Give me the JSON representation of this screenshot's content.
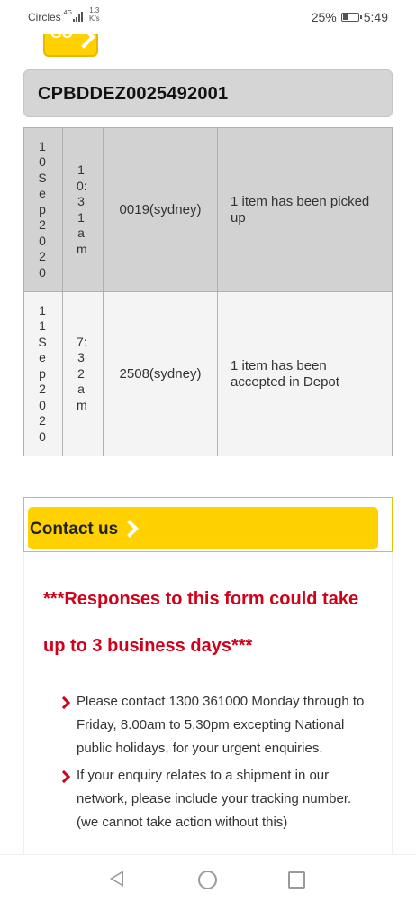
{
  "status_bar": {
    "carrier": "Circles",
    "network": "4G",
    "speed_value": "1.3",
    "speed_unit": "K/s",
    "battery": "25%",
    "time": "5:49"
  },
  "go_button": {
    "label": "GO"
  },
  "tracking_number": "CPBDDEZ0025492001",
  "events": [
    {
      "date": "10Sep2020",
      "time": "10:31am",
      "location": "0019(sydney)",
      "description": "1 item has been picked up"
    },
    {
      "date": "11Sep2020",
      "time": "7:32am",
      "location": "2508(sydney)",
      "description": "1 item has been accepted in Depot"
    }
  ],
  "contact": {
    "label": "Contact us"
  },
  "form_note": {
    "warning": "***Responses to this form could take up to 3 business days***",
    "bullets": [
      "Please contact 1300 361000 Monday through to Friday, 8.00am to 5.30pm excepting National public holidays, for your urgent enquiries.",
      "If your enquiry relates to a shipment in our network, please include your tracking number. (we cannot take action without this)"
    ]
  },
  "colors": {
    "accent_yellow": "#ffd100",
    "alert_red": "#d0021b",
    "row_gray": "#d2d2d2"
  },
  "nav": {
    "back_icon": "back-triangle-icon",
    "home_icon": "home-circle-icon",
    "recent_icon": "recent-square-icon"
  }
}
